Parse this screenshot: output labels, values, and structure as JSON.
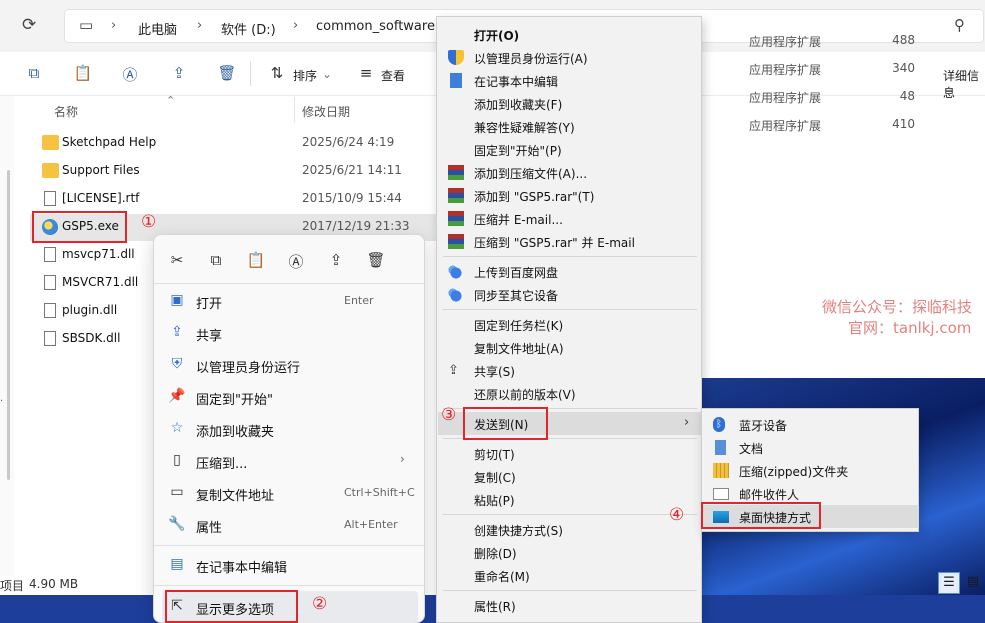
{
  "breadcrumb": [
    "此电脑",
    "软件 (D:)",
    "common_software"
  ],
  "toolbar": {
    "sort": "排序",
    "view": "查看",
    "details": "详细信息"
  },
  "columns": {
    "name": "名称",
    "date": "修改日期"
  },
  "files": [
    {
      "name": "Sketchpad Help",
      "date": "2025/6/24 4:19",
      "type": "folder"
    },
    {
      "name": "Support Files",
      "date": "2025/6/21 14:11",
      "type": "folder"
    },
    {
      "name": "[LICENSE].rtf",
      "date": "2015/10/9 15:44",
      "type": "doc"
    },
    {
      "name": "GSP5.exe",
      "date": "2017/12/19 21:33",
      "type": "exe"
    },
    {
      "name": "msvcp71.dll",
      "date": "",
      "type": "doc"
    },
    {
      "name": "MSVCR71.dll",
      "date": "",
      "type": "doc"
    },
    {
      "name": "plugin.dll",
      "date": "",
      "type": "doc"
    },
    {
      "name": "SBSDK.dll",
      "date": "",
      "type": "doc"
    }
  ],
  "ext_rows": [
    {
      "type": "应用程序扩展",
      "size": "488"
    },
    {
      "type": "应用程序扩展",
      "size": "340"
    },
    {
      "type": "应用程序扩展",
      "size": "48"
    },
    {
      "type": "应用程序扩展",
      "size": "410"
    }
  ],
  "status": {
    "items": "项目",
    "size": "4.90 MB"
  },
  "modern_menu": {
    "items": [
      {
        "label": "打开",
        "key": "Enter",
        "icon": "open-icon"
      },
      {
        "label": "共享",
        "key": "",
        "icon": "share-icon"
      },
      {
        "label": "以管理员身份运行",
        "key": "",
        "icon": "shield-icon"
      },
      {
        "label": "固定到\"开始\"",
        "key": "",
        "icon": "pin-icon"
      },
      {
        "label": "添加到收藏夹",
        "key": "",
        "icon": "star-icon"
      },
      {
        "label": "压缩到...",
        "key": "",
        "icon": "zip-icon"
      },
      {
        "label": "复制文件地址",
        "key": "Ctrl+Shift+C",
        "icon": "path-icon"
      },
      {
        "label": "属性",
        "key": "Alt+Enter",
        "icon": "wrench-icon"
      },
      {
        "label": "在记事本中编辑",
        "key": "",
        "icon": "notepad-icon"
      },
      {
        "label": "显示更多选项",
        "key": "",
        "icon": "more-options-icon"
      }
    ]
  },
  "classic_menu": {
    "items": [
      {
        "label": "打开(O)",
        "bold": true,
        "icon": ""
      },
      {
        "label": "以管理员身份运行(A)",
        "icon": "shield"
      },
      {
        "label": "在记事本中编辑",
        "icon": "notepad"
      },
      {
        "label": "添加到收藏夹(F)",
        "icon": ""
      },
      {
        "label": "兼容性疑难解答(Y)",
        "icon": ""
      },
      {
        "label": "固定到\"开始\"(P)",
        "icon": ""
      },
      {
        "label": "添加到压缩文件(A)...",
        "icon": "rar"
      },
      {
        "label": "添加到 \"GSP5.rar\"(T)",
        "icon": "rar"
      },
      {
        "label": "压缩并 E-mail...",
        "icon": "rar"
      },
      {
        "label": "压缩到 \"GSP5.rar\" 并 E-mail",
        "icon": "rar"
      },
      {
        "label": "上传到百度网盘",
        "icon": "baidu"
      },
      {
        "label": "同步至其它设备",
        "icon": "baidu"
      },
      {
        "label": "固定到任务栏(K)",
        "icon": ""
      },
      {
        "label": "复制文件地址(A)",
        "icon": ""
      },
      {
        "label": "共享(S)",
        "icon": "share"
      },
      {
        "label": "还原以前的版本(V)",
        "icon": ""
      },
      {
        "label": "发送到(N)",
        "icon": ""
      },
      {
        "label": "剪切(T)",
        "icon": ""
      },
      {
        "label": "复制(C)",
        "icon": ""
      },
      {
        "label": "粘贴(P)",
        "icon": ""
      },
      {
        "label": "创建快捷方式(S)",
        "icon": ""
      },
      {
        "label": "删除(D)",
        "icon": ""
      },
      {
        "label": "重命名(M)",
        "icon": ""
      },
      {
        "label": "属性(R)",
        "icon": ""
      }
    ]
  },
  "sendto_menu": {
    "items": [
      {
        "label": "蓝牙设备",
        "icon": "bluetooth-icon"
      },
      {
        "label": "文档",
        "icon": "document-icon"
      },
      {
        "label": "压缩(zipped)文件夹",
        "icon": "zip-folder-icon"
      },
      {
        "label": "邮件收件人",
        "icon": "mail-icon"
      },
      {
        "label": "桌面快捷方式",
        "icon": "desktop-icon"
      }
    ]
  },
  "annotations": [
    "①",
    "②",
    "③",
    "④"
  ],
  "watermark": {
    "line1": "微信公众号：探临科技",
    "line2": "官网：tanlkj.com"
  },
  "colors": {
    "accent": "#2f6dc8",
    "annotation": "#e0262b",
    "taskbar": "#1d3f9b"
  }
}
